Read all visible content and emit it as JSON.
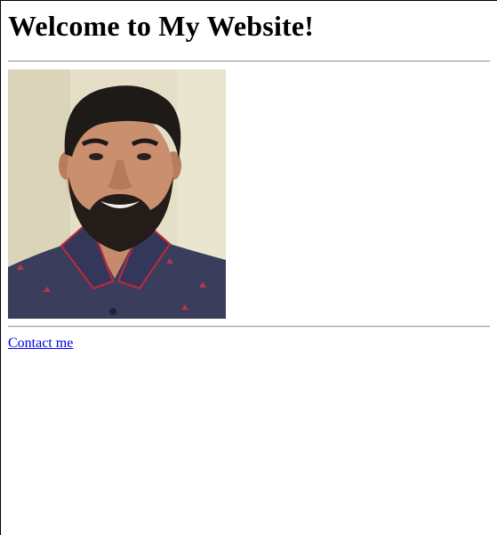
{
  "page": {
    "heading": "Welcome to My Website!",
    "contact_link": "Contact me"
  },
  "colors": {
    "link": "#0000ee",
    "background": "#ffffff",
    "photo_wall": "#e6e1c8",
    "shirt": "#3c3f5e"
  },
  "image": {
    "alt_description_icon": "profile-photo"
  }
}
